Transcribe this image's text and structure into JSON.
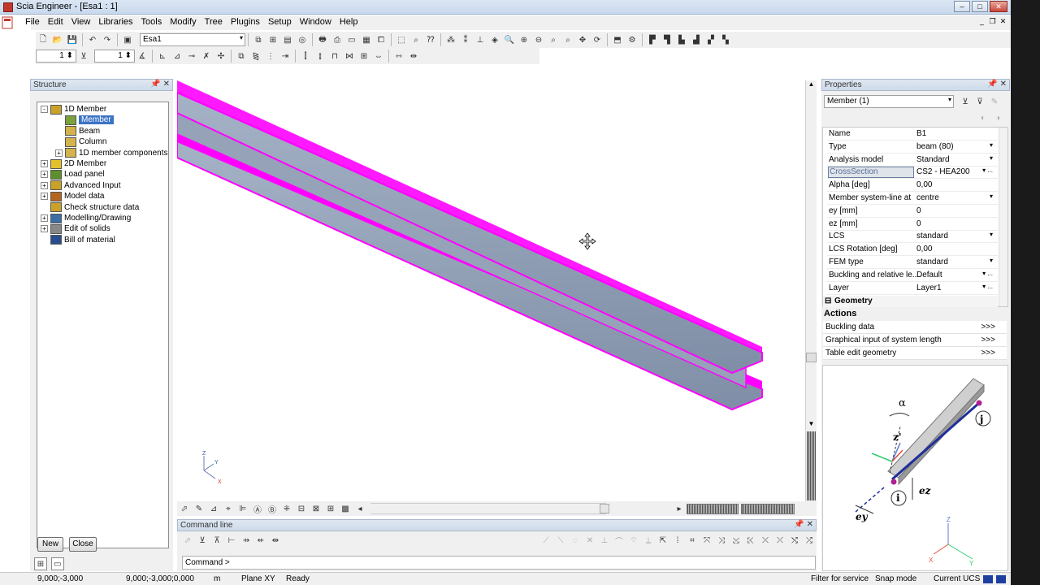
{
  "window": {
    "title": "Scia Engineer - [Esa1 : 1]"
  },
  "menu": [
    "File",
    "Edit",
    "View",
    "Libraries",
    "Tools",
    "Modify",
    "Tree",
    "Plugins",
    "Setup",
    "Window",
    "Help"
  ],
  "toolbar": {
    "project_combo": "Esa1",
    "spin1": "1",
    "spin2": "1"
  },
  "structure": {
    "title": "Structure",
    "items": [
      {
        "label": "1D Member",
        "level": 0,
        "expander": "-"
      },
      {
        "label": "Member",
        "level": 1,
        "selected": true
      },
      {
        "label": "Beam",
        "level": 1
      },
      {
        "label": "Column",
        "level": 1
      },
      {
        "label": "1D member components",
        "level": 1,
        "expander": "+"
      },
      {
        "label": "2D Member",
        "level": 0,
        "expander": "+"
      },
      {
        "label": "Load panel",
        "level": 0,
        "expander": "+"
      },
      {
        "label": "Advanced Input",
        "level": 0,
        "expander": "+"
      },
      {
        "label": "Model data",
        "level": 0,
        "expander": "+"
      },
      {
        "label": "Check structure data",
        "level": 0
      },
      {
        "label": "Modelling/Drawing",
        "level": 0,
        "expander": "+"
      },
      {
        "label": "Edit of solids",
        "level": 0,
        "expander": "+"
      },
      {
        "label": "Bill of material",
        "level": 0
      }
    ],
    "new_button": "New",
    "close_button": "Close"
  },
  "viewport": {
    "axis_z": "Z",
    "axis_y": "Y",
    "axis_x": "X"
  },
  "command_line": {
    "title": "Command line",
    "prompt": "Command >"
  },
  "properties": {
    "title": "Properties",
    "selector": "Member (1)",
    "rows": [
      {
        "key": "Name",
        "value": "B1",
        "dd": ""
      },
      {
        "key": "Type",
        "value": "beam (80)",
        "dd": "▾"
      },
      {
        "key": "Analysis model",
        "value": "Standard",
        "dd": "▾"
      },
      {
        "key": "CrossSection",
        "value": "CS2 - HEA200",
        "dd": "▾ ..."
      },
      {
        "key": "Alpha [deg]",
        "value": "0,00",
        "dd": ""
      },
      {
        "key": "Member system-line at",
        "value": "centre",
        "dd": "▾"
      },
      {
        "key": "ey [mm]",
        "value": "0",
        "dd": ""
      },
      {
        "key": "ez [mm]",
        "value": "0",
        "dd": ""
      },
      {
        "key": "LCS",
        "value": "standard",
        "dd": "▾"
      },
      {
        "key": "LCS Rotation [deg]",
        "value": "0,00",
        "dd": ""
      },
      {
        "key": "FEM type",
        "value": "standard",
        "dd": "▾"
      },
      {
        "key": "Buckling and relative le...",
        "value": "Default",
        "dd": "▾ ..."
      },
      {
        "key": "Layer",
        "value": "Layer1",
        "dd": "▾ ..."
      }
    ],
    "group": "Geometry",
    "actions_title": "Actions",
    "actions": [
      {
        "label": "Buckling data",
        "arrow": ">>>"
      },
      {
        "label": "Graphical input of system length",
        "arrow": ">>>"
      },
      {
        "label": "Table edit geometry",
        "arrow": ">>>"
      }
    ],
    "diagram": {
      "alpha": "α",
      "z": "z'",
      "j": "j",
      "i": "i",
      "ez": "ez",
      "ey": "ey",
      "axis_z": "Z",
      "axis_x": "X",
      "axis_y": "Y"
    }
  },
  "status": {
    "coord1": "9,000;-3,000",
    "coord2": "9,000;-3,000;0,000",
    "unit": "m",
    "plane": "Plane XY",
    "ready": "Ready",
    "filter": "Filter for service",
    "snap": "Snap mode",
    "ucs": "Current UCS"
  },
  "colors": {
    "highlight": "#ff00ff",
    "beam": "#8c9ab0",
    "selection": "#3a74c6"
  }
}
